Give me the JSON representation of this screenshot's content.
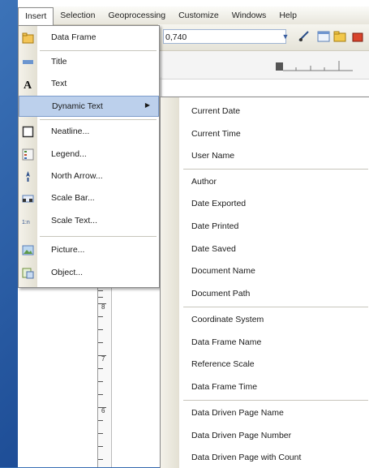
{
  "menubar": {
    "items": [
      "Insert",
      "Selection",
      "Geoprocessing",
      "Customize",
      "Windows",
      "Help"
    ]
  },
  "toolbar": {
    "scale_value": "0,740"
  },
  "insert_menu": {
    "items": [
      {
        "label": "Data Frame",
        "icon": "data-frame-icon"
      },
      {
        "label": "Title",
        "icon": "title-icon"
      },
      {
        "label": "Text",
        "icon": "text-icon"
      },
      {
        "label": "Dynamic Text",
        "icon": "",
        "has_submenu": true
      },
      {
        "label": "Neatline...",
        "icon": "neatline-icon"
      },
      {
        "label": "Legend...",
        "icon": "legend-icon"
      },
      {
        "label": "North Arrow...",
        "icon": "north-arrow-icon"
      },
      {
        "label": "Scale Bar...",
        "icon": "scale-bar-icon"
      },
      {
        "label": "Scale Text...",
        "icon": "scale-text-icon"
      },
      {
        "label": "Picture...",
        "icon": "picture-icon"
      },
      {
        "label": "Object...",
        "icon": "object-icon"
      }
    ]
  },
  "dynamic_text_menu": {
    "items": [
      "Current Date",
      "Current Time",
      "User Name",
      "Author",
      "Date Exported",
      "Date Printed",
      "Date Saved",
      "Document Name",
      "Document Path",
      "Coordinate System",
      "Data Frame Name",
      "Reference Scale",
      "Data Frame Time",
      "Data Driven Page Name",
      "Data Driven Page Number",
      "Data Driven Page with Count"
    ]
  },
  "ruler": {
    "labels": [
      "8",
      "7",
      "6"
    ]
  },
  "colors": {
    "highlight": "#bcd0ec",
    "desktop": "#1f4f98"
  }
}
